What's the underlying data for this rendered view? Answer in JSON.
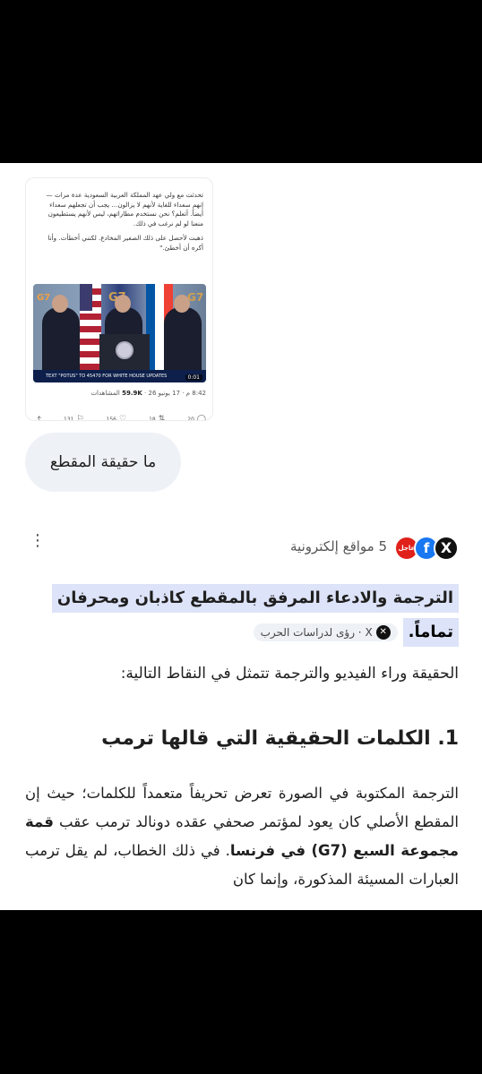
{
  "tweet": {
    "text1": "تحدثت مع ولي عهد المملكة العربية السعودية عدة مرات — إنهم سعداء للغاية لأنهم لا يزالون... يجب أن تجعلهم سعداء أيضاً. أتعلم؟ نحن نستخدم مطاراتهم، ليس لأنهم يستطيعون منعنا لو لم نرغب في ذلك.",
    "text2": "ذهبت لأحصل على ذلك الصغير المخادع. لكنني أخطأت. وأنا أكره أن أخطئ.\"",
    "video_banner": "TEXT \"POTUS\" TO 45470 FOR WHITE HOUSE UPDATES",
    "video_time": "0:01",
    "g7": "G7",
    "meta_time": "8:42 م · 17 يونيو 26 ·",
    "meta_views_num": "59.9K",
    "meta_views_label": "المشاهدات",
    "actions": {
      "replies": "20",
      "reposts": "18",
      "likes": "156",
      "bookmarks": "131"
    }
  },
  "query": "ما حقيقة المقطع",
  "sources": {
    "label": "5 مواقع إلكترونية",
    "news_icon": "عاجل",
    "fb_icon": "f",
    "x_icon": "X"
  },
  "answer": {
    "claim_line1": "الترجمة والادعاء المرفق بالمقطع كاذبان ومحرفان",
    "claim_line2": "تماماً.",
    "chip_label": "X · رؤى لدراسات الحرب",
    "intro": "الحقيقة وراء الفيديو والترجمة تتمثل في النقاط التالية:",
    "heading": "1. الكلمات الحقيقية التي قالها ترمب",
    "para_part1": "الترجمة المكتوبة في الصورة تعرض تحريفاً متعمداً للكلمات؛ حيث إن المقطع الأصلي كان يعود لمؤتمر صحفي عقده دونالد ترمب عقب",
    "para_bold": "قمة مجموعة السبع (G7) في فرنسا",
    "para_part2": ". في ذلك الخطاب، لم يقل ترمب العبارات المسيئة المذكورة، وإنما كان"
  }
}
